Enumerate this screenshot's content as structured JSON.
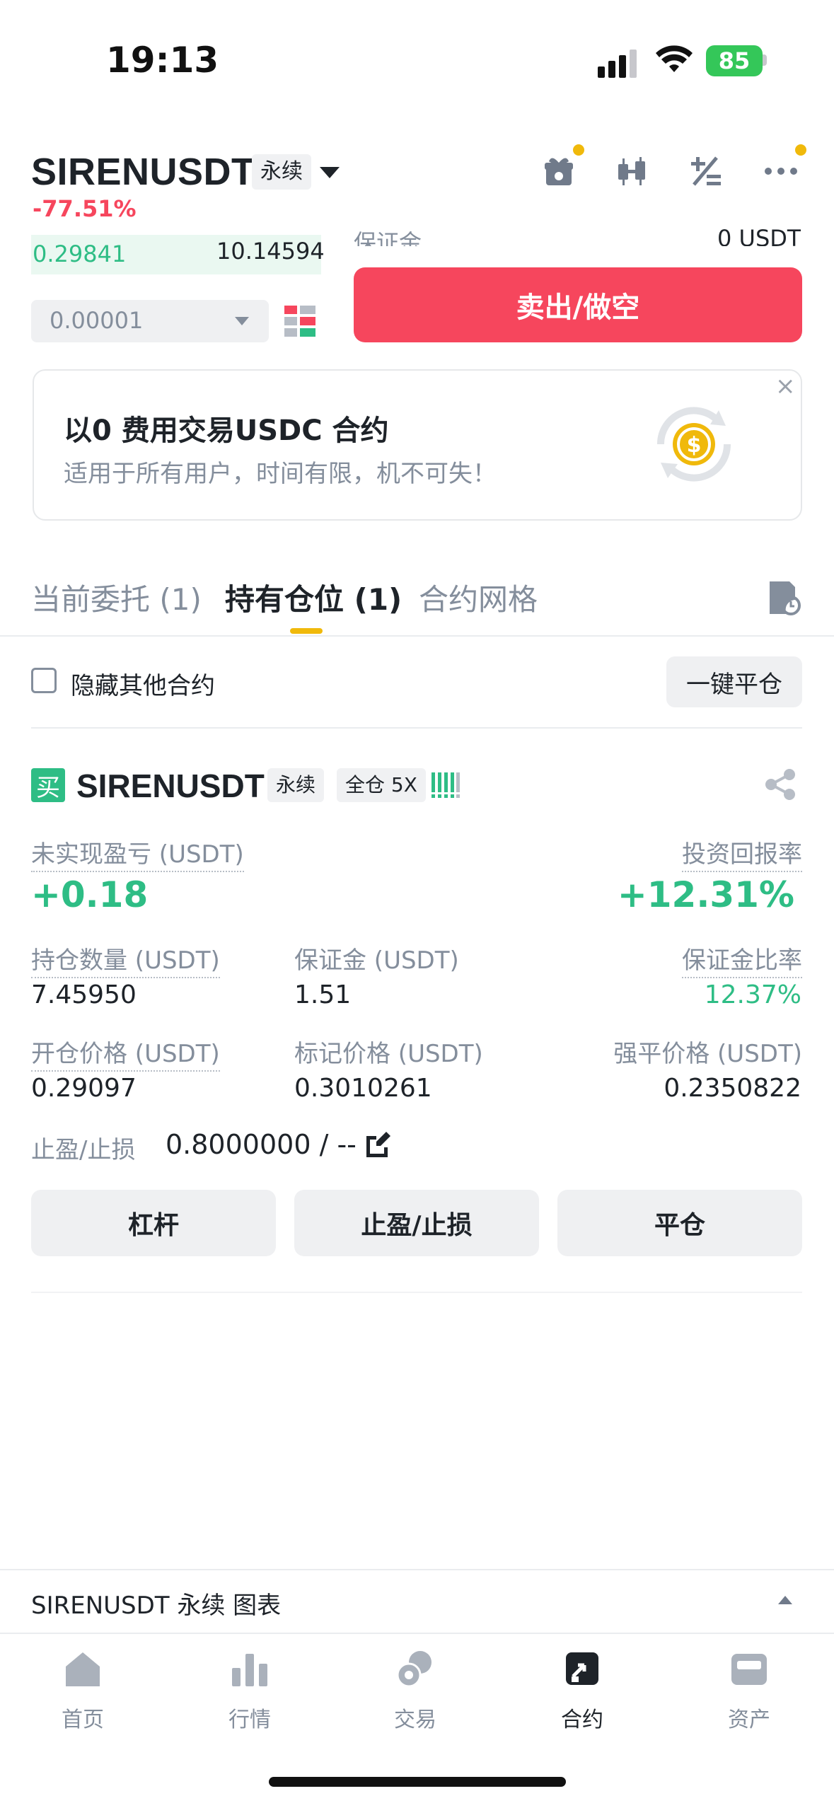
{
  "status_bar": {
    "time": "19:13",
    "battery": "85"
  },
  "header": {
    "pair": "SIRENUSDT",
    "contract_type": "永续",
    "change": "-77.51%",
    "icons": [
      "gift-icon",
      "candlestick-icon",
      "calculator-icon",
      "more-icon"
    ]
  },
  "order_book": {
    "price": "0.29841",
    "qty": "10.14594",
    "step": "0.00001"
  },
  "order_form": {
    "margin_label_cut": "保证金",
    "margin_value_cut": "0 USDT",
    "sell_button": "卖出/做空"
  },
  "banner": {
    "title": "以0 费用交易USDC 合约",
    "subtitle": "适用于所有用户，时间有限，机不可失！",
    "close": "×"
  },
  "tabs": [
    {
      "label": "当前委托 (1)"
    },
    {
      "label": "持有仓位 (1)"
    },
    {
      "label": "合约网格"
    }
  ],
  "positions_bar": {
    "hide_other": "隐藏其他合约",
    "close_all": "一键平仓"
  },
  "position": {
    "side": "买",
    "pair": "SIRENUSDT",
    "contract_type": "永续",
    "margin_mode": "全仓 5X",
    "unrealized_pnl_label": "未实现盈亏 (USDT)",
    "unrealized_pnl": "+0.18",
    "roi_label": "投资回报率",
    "roi": "+12.31%",
    "size_label": "持仓数量 (USDT)",
    "size": "7.45950",
    "margin_label": "保证金 (USDT)",
    "margin": "1.51",
    "margin_ratio_label": "保证金比率",
    "margin_ratio": "12.37%",
    "entry_label": "开仓价格 (USDT)",
    "entry": "0.29097",
    "mark_label": "标记价格 (USDT)",
    "mark": "0.3010261",
    "liq_label": "强平价格 (USDT)",
    "liq": "0.2350822",
    "tpsl_label": "止盈/止损",
    "tpsl": "0.8000000 / --",
    "buttons": {
      "leverage": "杠杆",
      "tpsl": "止盈/止损",
      "close": "平仓"
    }
  },
  "chart_bar": {
    "label": "SIRENUSDT 永续  图表"
  },
  "nav": [
    {
      "label": "首页"
    },
    {
      "label": "行情"
    },
    {
      "label": "交易"
    },
    {
      "label": "合约"
    },
    {
      "label": "资产"
    }
  ],
  "colors": {
    "red": "#f6465d",
    "green": "#2ebd85",
    "accent": "#f0b90b"
  }
}
